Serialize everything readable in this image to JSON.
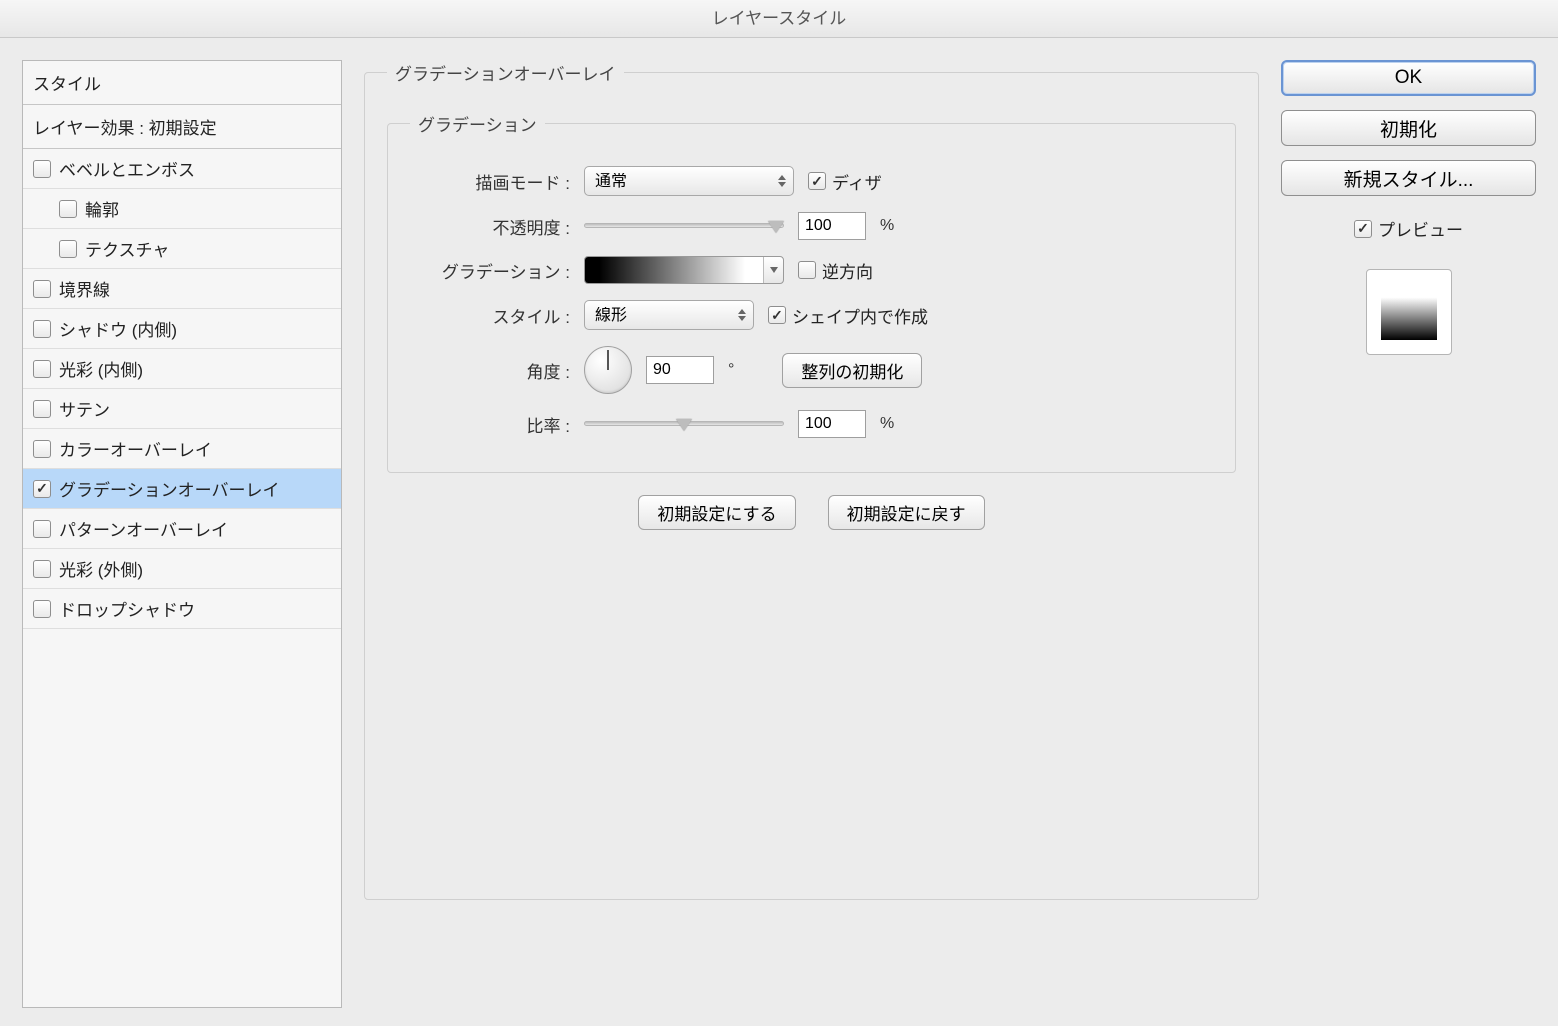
{
  "title": "レイヤースタイル",
  "sidebar": {
    "header": "スタイル",
    "blending": "レイヤー効果 : 初期設定",
    "items": [
      {
        "label": "ベベルとエンボス",
        "checked": false,
        "indent": false
      },
      {
        "label": "輪郭",
        "checked": false,
        "indent": true
      },
      {
        "label": "テクスチャ",
        "checked": false,
        "indent": true
      },
      {
        "label": "境界線",
        "checked": false,
        "indent": false
      },
      {
        "label": "シャドウ (内側)",
        "checked": false,
        "indent": false
      },
      {
        "label": "光彩 (内側)",
        "checked": false,
        "indent": false
      },
      {
        "label": "サテン",
        "checked": false,
        "indent": false
      },
      {
        "label": "カラーオーバーレイ",
        "checked": false,
        "indent": false
      },
      {
        "label": "グラデーションオーバーレイ",
        "checked": true,
        "indent": false,
        "selected": true
      },
      {
        "label": "パターンオーバーレイ",
        "checked": false,
        "indent": false
      },
      {
        "label": "光彩 (外側)",
        "checked": false,
        "indent": false
      },
      {
        "label": "ドロップシャドウ",
        "checked": false,
        "indent": false
      }
    ]
  },
  "settings": {
    "outer_legend": "グラデーションオーバーレイ",
    "inner_legend": "グラデーション",
    "blend_mode_label": "描画モード :",
    "blend_mode_value": "通常",
    "dither_label": "ディザ",
    "dither_checked": true,
    "opacity_label": "不透明度 :",
    "opacity_value": "100",
    "opacity_unit": "%",
    "gradient_label": "グラデーション :",
    "reverse_label": "逆方向",
    "reverse_checked": false,
    "style_label": "スタイル :",
    "style_value": "線形",
    "align_label": "シェイプ内で作成",
    "align_checked": true,
    "angle_label": "角度 :",
    "angle_value": "90",
    "angle_unit": "°",
    "reset_align_btn": "整列の初期化",
    "scale_label": "比率 :",
    "scale_value": "100",
    "scale_unit": "%",
    "make_default_btn": "初期設定にする",
    "reset_default_btn": "初期設定に戻す"
  },
  "right": {
    "ok": "OK",
    "cancel": "初期化",
    "new_style": "新規スタイル...",
    "preview_label": "プレビュー",
    "preview_checked": true
  }
}
